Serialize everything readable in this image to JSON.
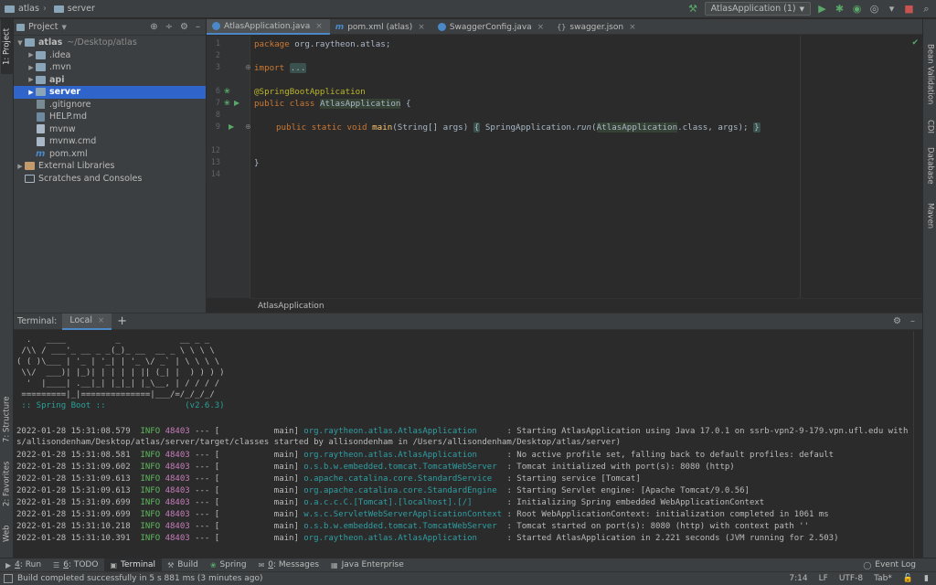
{
  "breadcrumb": [
    "atlas",
    "server"
  ],
  "run_config": {
    "label": "AtlasApplication (1)",
    "run_color": "#59a869"
  },
  "left_stripe": {
    "project": "1: Project",
    "structure": "7: Structure",
    "favorites": "2: Favorites",
    "web": "Web"
  },
  "right_stripe": {
    "bean": "Bean Validation",
    "cdi": "CDI",
    "database": "Database",
    "maven": "Maven"
  },
  "project_panel": {
    "title": "Project",
    "tree": [
      {
        "name": "atlas",
        "hint": "~/Desktop/atlas"
      },
      {
        "name": ".idea"
      },
      {
        "name": ".mvn"
      },
      {
        "name": "api"
      },
      {
        "name": "server"
      },
      {
        "name": ".gitignore"
      },
      {
        "name": "HELP.md"
      },
      {
        "name": "mvnw"
      },
      {
        "name": "mvnw.cmd"
      },
      {
        "name": "pom.xml"
      },
      {
        "name": "External Libraries"
      },
      {
        "name": "Scratches and Consoles"
      }
    ]
  },
  "editor": {
    "tabs": [
      "AtlasApplication.java",
      "pom.xml (atlas)",
      "SwaggerConfig.java",
      "swagger.json"
    ],
    "line_numbers": [
      "1",
      "2",
      "3",
      "6",
      "7",
      "8",
      "9",
      "12",
      "13",
      "14"
    ],
    "code": {
      "l1_kw": "package",
      "l1_rest": " org.raytheon.atlas;",
      "l3_kw": "import",
      "l3_fold": "...",
      "l6": "@SpringBootApplication",
      "l7_kw": "public class",
      "l7_cls": "AtlasApplication",
      "l7_rest": " {",
      "l9_kw": "public static void",
      "l9_fn": "main",
      "l9_args": "(String[] args) ",
      "l9_open": "{",
      "l9_mid": " SpringApplication.",
      "l9_run": "run",
      "l9_paren": "(",
      "l9_cls": "AtlasApplication",
      "l9_tail": ".class, args); ",
      "l9_close": "}",
      "l13": "}"
    },
    "breadcrumb": "AtlasApplication"
  },
  "terminal": {
    "title": "Terminal:",
    "tab": "Local",
    "banner": [
      "  .   ____          _            __ _ _",
      " /\\\\ / ___'_ __ _ _(_)_ __  __ _ \\ \\ \\ \\",
      "( ( )\\___ | '_ | '_| | '_ \\/ _` | \\ \\ \\ \\",
      " \\\\/  ___)| |_)| | | | | || (_| |  ) ) ) )",
      "  '  |____| .__|_| |_|_| |_\\__, | / / / /",
      " =========|_|==============|___/=/_/_/_/"
    ],
    "spring_label": " :: Spring Boot ::                (v2.6.3)",
    "logs": [
      {
        "ts": "2022-01-28 15:31:08.579",
        "level": "INFO",
        "pid": "48403",
        "thread": " --- [           main] ",
        "logger": "org.raytheon.atlas.AtlasApplication     ",
        "msg": " : Starting AtlasApplication using Java 17.0.1 on ssrb-vpn2-9-179.vpn.ufl.edu with PID 48403 (/User"
      },
      {
        "ts": "2022-01-28 15:31:08.581",
        "level": "INFO",
        "pid": "48403",
        "thread": " --- [           main] ",
        "logger": "org.raytheon.atlas.AtlasApplication     ",
        "msg": " : No active profile set, falling back to default profiles: default"
      },
      {
        "ts": "2022-01-28 15:31:09.602",
        "level": "INFO",
        "pid": "48403",
        "thread": " --- [           main] ",
        "logger": "o.s.b.w.embedded.tomcat.TomcatWebServer ",
        "msg": " : Tomcat initialized with port(s): 8080 (http)"
      },
      {
        "ts": "2022-01-28 15:31:09.613",
        "level": "INFO",
        "pid": "48403",
        "thread": " --- [           main] ",
        "logger": "o.apache.catalina.core.StandardService  ",
        "msg": " : Starting service [Tomcat]"
      },
      {
        "ts": "2022-01-28 15:31:09.613",
        "level": "INFO",
        "pid": "48403",
        "thread": " --- [           main] ",
        "logger": "org.apache.catalina.core.StandardEngine ",
        "msg": " : Starting Servlet engine: [Apache Tomcat/9.0.56]"
      },
      {
        "ts": "2022-01-28 15:31:09.699",
        "level": "INFO",
        "pid": "48403",
        "thread": " --- [           main] ",
        "logger": "o.a.c.c.C.[Tomcat].[localhost].[/]      ",
        "msg": " : Initializing Spring embedded WebApplicationContext"
      },
      {
        "ts": "2022-01-28 15:31:09.699",
        "level": "INFO",
        "pid": "48403",
        "thread": " --- [           main] ",
        "logger": "w.s.c.ServletWebServerApplicationContext",
        "msg": " : Root WebApplicationContext: initialization completed in 1061 ms"
      },
      {
        "ts": "2022-01-28 15:31:10.218",
        "level": "INFO",
        "pid": "48403",
        "thread": " --- [           main] ",
        "logger": "o.s.b.w.embedded.tomcat.TomcatWebServer ",
        "msg": " : Tomcat started on port(s): 8080 (http) with context path ''"
      },
      {
        "ts": "2022-01-28 15:31:10.391",
        "level": "INFO",
        "pid": "48403",
        "thread": " --- [           main] ",
        "logger": "org.raytheon.atlas.AtlasApplication     ",
        "msg": " : Started AtlasApplication in 2.221 seconds (JVM running for 2.503)"
      }
    ],
    "wrap_line": "s/allisondenham/Desktop/atlas/server/target/classes started by allisondenham in /Users/allisondenham/Desktop/atlas/server)"
  },
  "bottom_tabs": [
    {
      "key": "4",
      "label": ": Run"
    },
    {
      "key": "6",
      "label": ": TODO"
    },
    {
      "key": "",
      "label": "Terminal"
    },
    {
      "key": "",
      "label": "Build"
    },
    {
      "key": "",
      "label": "Spring"
    },
    {
      "key": "0",
      "label": ": Messages"
    },
    {
      "key": "",
      "label": "Java Enterprise"
    }
  ],
  "event_log": "Event Log",
  "status": {
    "message": "Build completed successfully in 5 s 881 ms (3 minutes ago)",
    "position": "7:14",
    "line_sep": "LF",
    "encoding": "UTF-8",
    "indent": "Tab*"
  }
}
